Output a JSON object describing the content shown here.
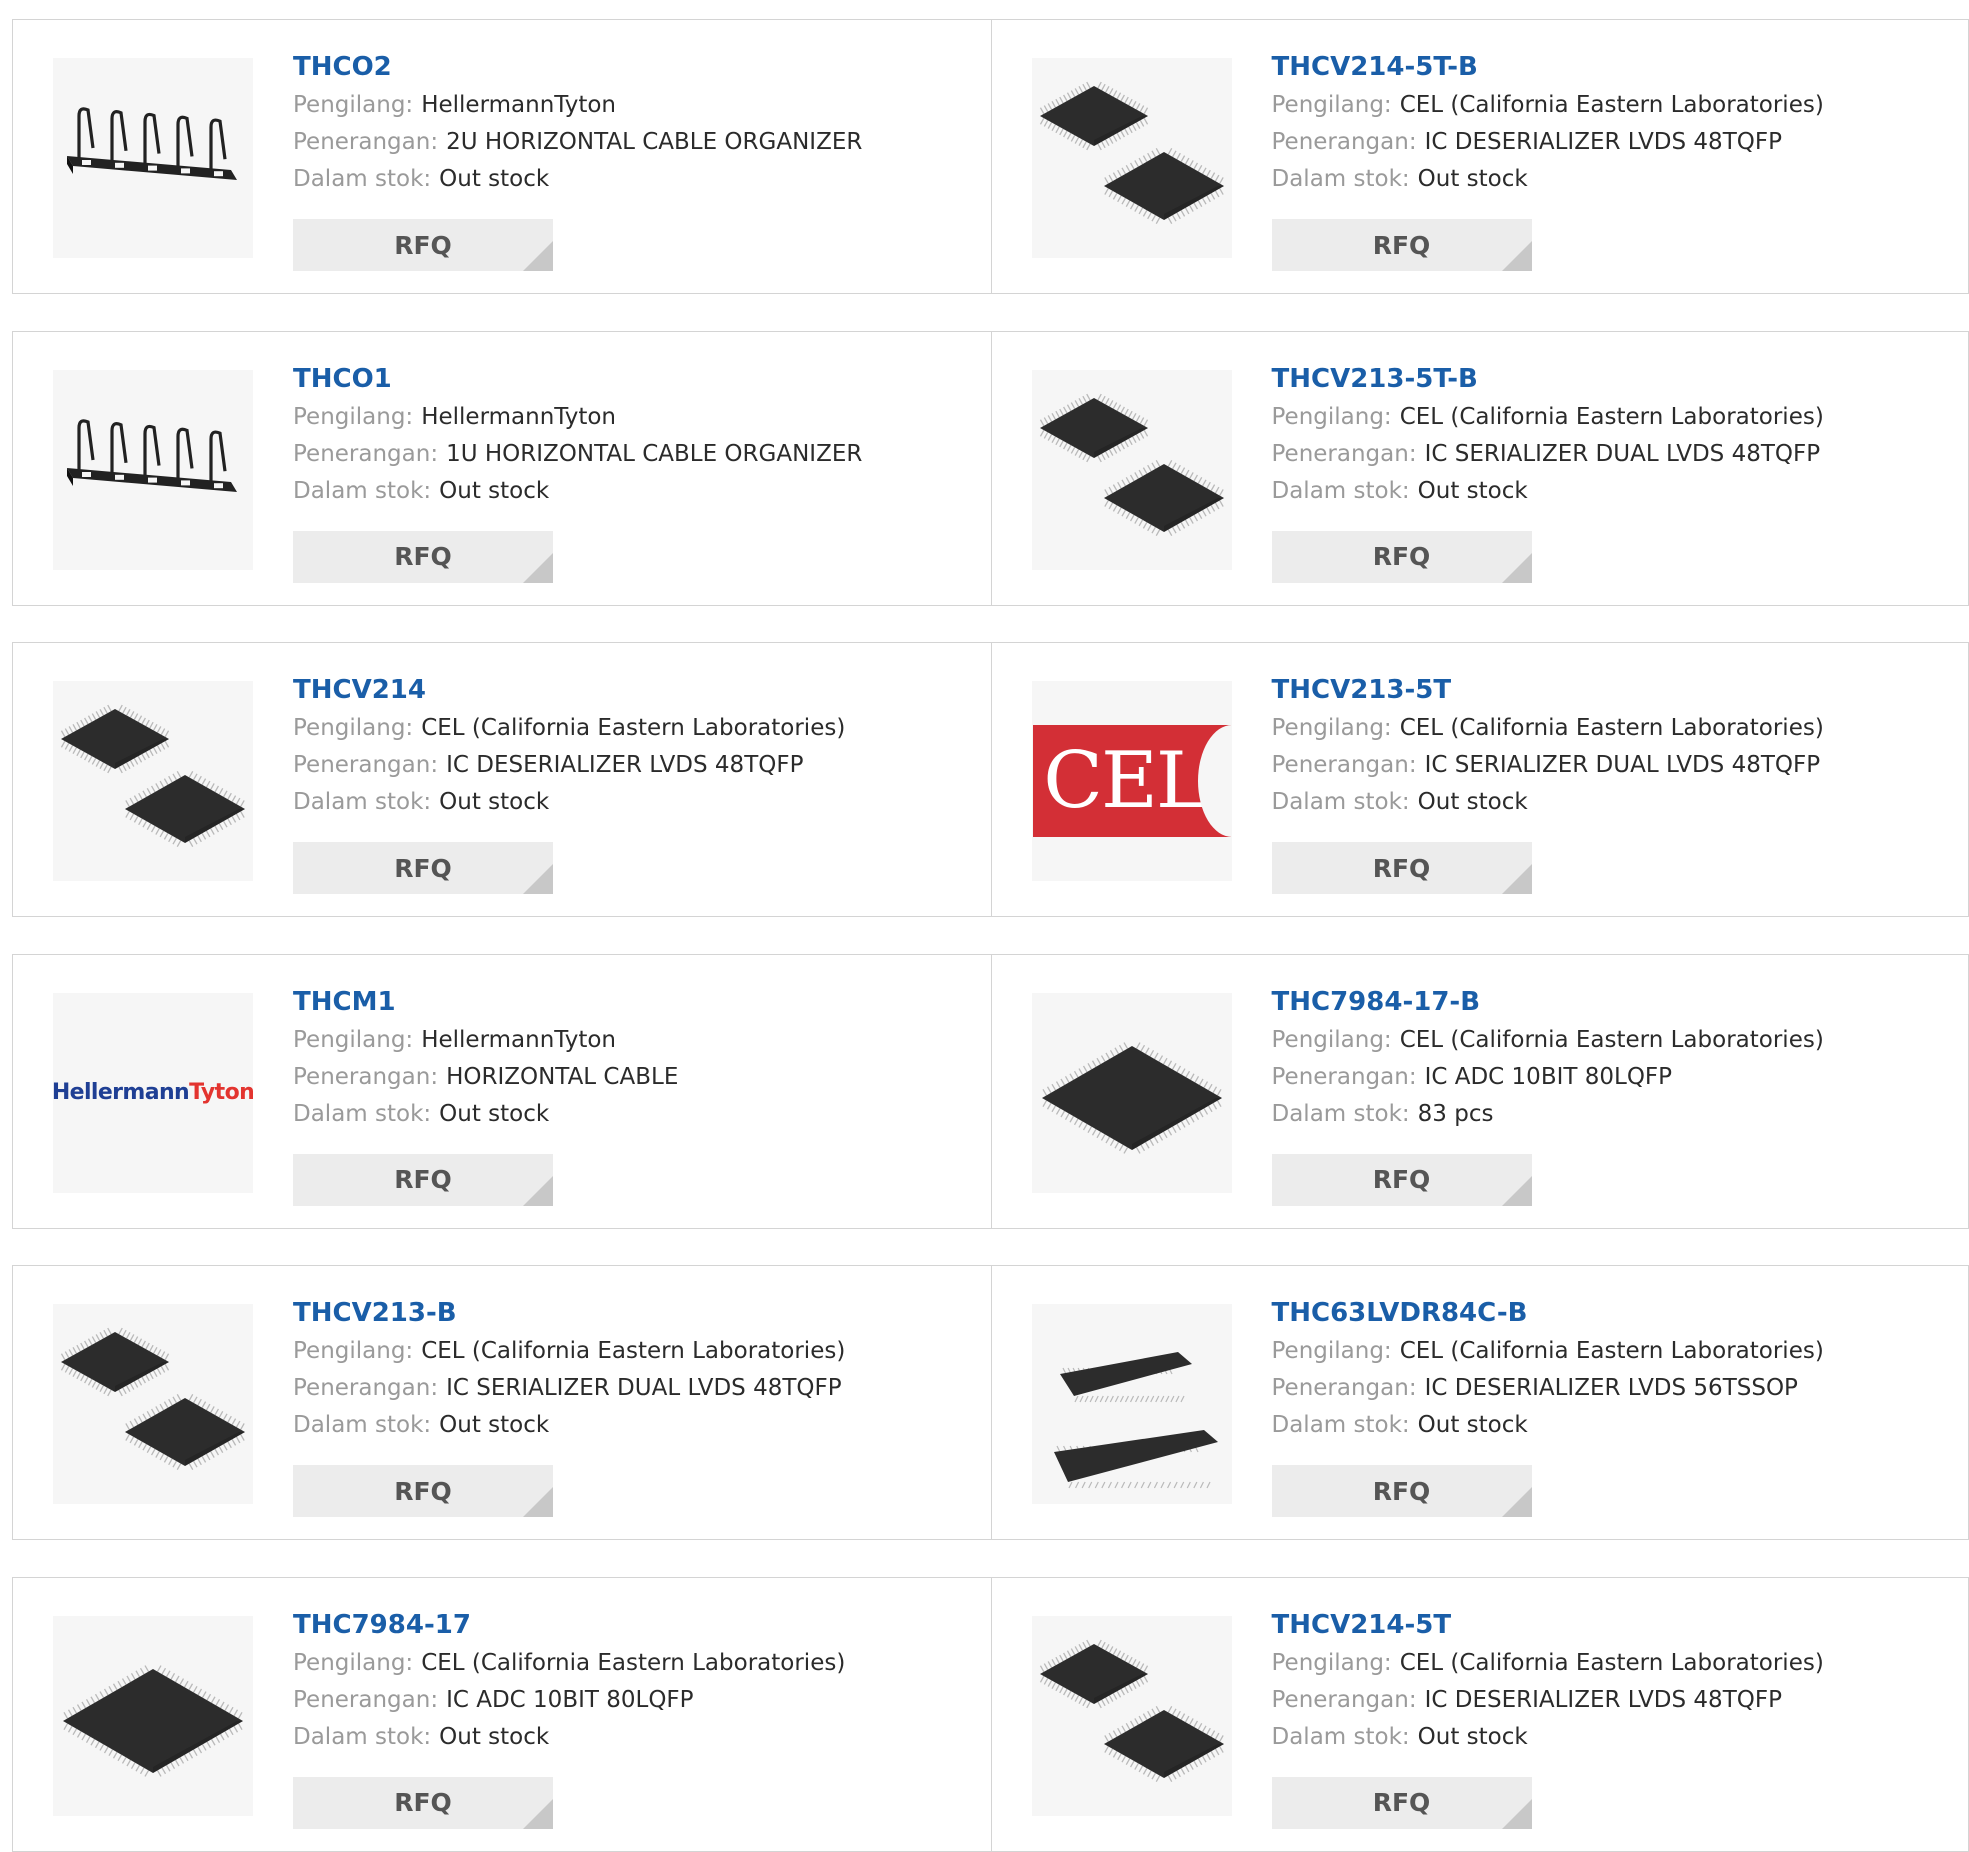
{
  "labels": {
    "manufacturer": "Pengilang:",
    "description": "Penerangan:",
    "stock": "Dalam stok:",
    "rfq": "RFQ"
  },
  "products": [
    {
      "part": "THCO2",
      "manufacturer": "HellermannTyton",
      "description": "2U HORIZONTAL CABLE ORGANIZER",
      "stock": "Out stock",
      "image": "cable-organizer-2u"
    },
    {
      "part": "THCV214-5T-B",
      "manufacturer": "CEL (California Eastern Laboratories)",
      "description": "IC DESERIALIZER LVDS 48TQFP",
      "stock": "Out stock",
      "image": "chip-tqfp-pair"
    },
    {
      "part": "THCO1",
      "manufacturer": "HellermannTyton",
      "description": "1U HORIZONTAL CABLE ORGANIZER",
      "stock": "Out stock",
      "image": "cable-organizer-1u"
    },
    {
      "part": "THCV213-5T-B",
      "manufacturer": "CEL (California Eastern Laboratories)",
      "description": "IC SERIALIZER DUAL LVDS 48TQFP",
      "stock": "Out stock",
      "image": "chip-tqfp-pair"
    },
    {
      "part": "THCV214",
      "manufacturer": "CEL (California Eastern Laboratories)",
      "description": "IC DESERIALIZER LVDS 48TQFP",
      "stock": "Out stock",
      "image": "chip-tqfp-pair"
    },
    {
      "part": "THCV213-5T",
      "manufacturer": "CEL (California Eastern Laboratories)",
      "description": "IC SERIALIZER DUAL LVDS 48TQFP",
      "stock": "Out stock",
      "image": "logo-cel",
      "logo_text": "CEL"
    },
    {
      "part": "THCM1",
      "manufacturer": "HellermannTyton",
      "description": "HORIZONTAL CABLE",
      "stock": "Out stock",
      "image": "logo-hellermanntyton",
      "logo_text_a": "Hellermann",
      "logo_text_b": "Tyton"
    },
    {
      "part": "THC7984-17-B",
      "manufacturer": "CEL (California Eastern Laboratories)",
      "description": "IC ADC 10BIT 80LQFP",
      "stock": "83 pcs",
      "image": "chip-lqfp-single"
    },
    {
      "part": "THCV213-B",
      "manufacturer": "CEL (California Eastern Laboratories)",
      "description": "IC SERIALIZER DUAL LVDS 48TQFP",
      "stock": "Out stock",
      "image": "chip-tqfp-pair"
    },
    {
      "part": "THC63LVDR84C-B",
      "manufacturer": "CEL (California Eastern Laboratories)",
      "description": "IC DESERIALIZER LVDS 56TSSOP",
      "stock": "Out stock",
      "image": "chip-tssop-pair"
    },
    {
      "part": "THC7984-17",
      "manufacturer": "CEL (California Eastern Laboratories)",
      "description": "IC ADC 10BIT 80LQFP",
      "stock": "Out stock",
      "image": "chip-lqfp-single"
    },
    {
      "part": "THCV214-5T",
      "manufacturer": "CEL (California Eastern Laboratories)",
      "description": "IC DESERIALIZER LVDS 48TQFP",
      "stock": "Out stock",
      "image": "chip-tqfp-pair"
    }
  ],
  "colors": {
    "part_link": "#1a5ea8",
    "label": "#9a9a9a",
    "value": "#2b2b2b",
    "rfq_bg": "#ececec",
    "cel_red": "#d32f36",
    "ht_blue": "#1f3f94",
    "ht_red": "#e3342f"
  }
}
